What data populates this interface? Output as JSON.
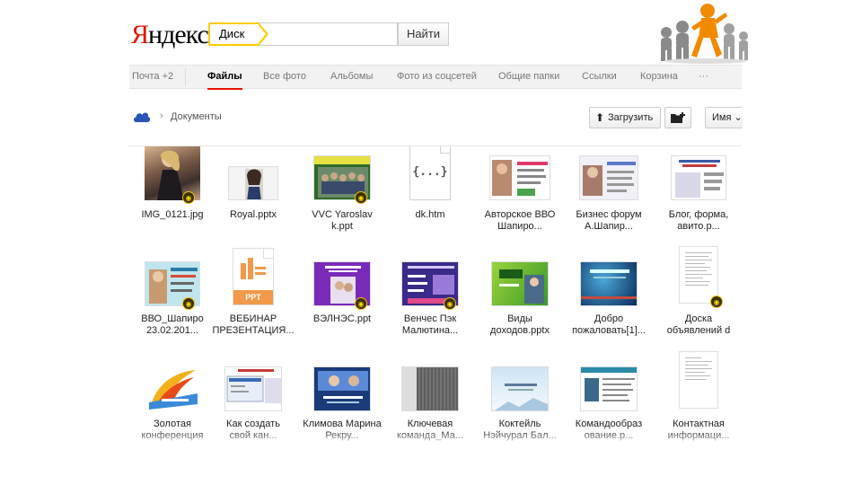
{
  "header": {
    "logo_first": "Я",
    "logo_rest": "ндекс",
    "search_tag": "Диск",
    "search_button": "Найти",
    "search_value": ""
  },
  "nav": {
    "items": [
      "Почта +2",
      "Файлы",
      "Все фото",
      "Альбомы",
      "Фото из соцсетей",
      "Общие папки",
      "Ссылки",
      "Корзина",
      "···"
    ],
    "active_index": 1
  },
  "breadcrumb": {
    "root_icon": "cloud-icon",
    "current": "Документы"
  },
  "toolbar": {
    "upload_label": "Загрузить",
    "sort_label": "Имя ⌄"
  },
  "colors": {
    "accent_red": "#e61400",
    "search_yellow": "#ffcc00",
    "nav_bg": "#f2f2f2"
  },
  "files": [
    {
      "name": "IMG_0121.jpg",
      "icon": "photo-thumbnail"
    },
    {
      "name": "Royal.pptx",
      "icon": "photo-thumbnail"
    },
    {
      "name": "VVC Yaroslav\nk.ppt",
      "icon": "presentation-thumbnail"
    },
    {
      "name": "dk.htm",
      "icon": "code-file-icon",
      "icon_text": "{...}"
    },
    {
      "name": "Авторское ВВО\nШапиро...",
      "icon": "presentation-thumbnail"
    },
    {
      "name": "Бизнес форум\nА.Шапир...",
      "icon": "presentation-thumbnail"
    },
    {
      "name": "Блог, форма,\nавито.р...",
      "icon": "presentation-thumbnail"
    },
    {
      "name": "ВВО_Шапиро\n23.02.201...",
      "icon": "presentation-thumbnail"
    },
    {
      "name": "ВЕБИНАР\nПРЕЗЕНТАЦИЯ...",
      "icon": "ppt-file-icon",
      "icon_text": "PPT"
    },
    {
      "name": "ВЭЛНЭС.ppt",
      "icon": "presentation-thumbnail"
    },
    {
      "name": "Венчес Пэк\nМалютина...",
      "icon": "presentation-thumbnail"
    },
    {
      "name": "Виды\nдоходов.pptx",
      "icon": "presentation-thumbnail"
    },
    {
      "name": "Добро\nпожаловать[1]...",
      "icon": "presentation-thumbnail"
    },
    {
      "name": "Доска\nобъявлений d",
      "icon": "document-thumbnail"
    },
    {
      "name": "Золотая\nконференция",
      "icon": "presentation-thumbnail"
    },
    {
      "name": "Как создать\nсвой кан...",
      "icon": "presentation-thumbnail"
    },
    {
      "name": "Климова Марина\nРекру...",
      "icon": "presentation-thumbnail"
    },
    {
      "name": "Ключевая\nкоманда_Ма...",
      "icon": "presentation-thumbnail"
    },
    {
      "name": "Коктейль\nНэйчурал Бал...",
      "icon": "presentation-thumbnail"
    },
    {
      "name": "Командообраз\nование.p...",
      "icon": "presentation-thumbnail"
    },
    {
      "name": "Контактная\nинформаци...",
      "icon": "document-thumbnail"
    }
  ]
}
